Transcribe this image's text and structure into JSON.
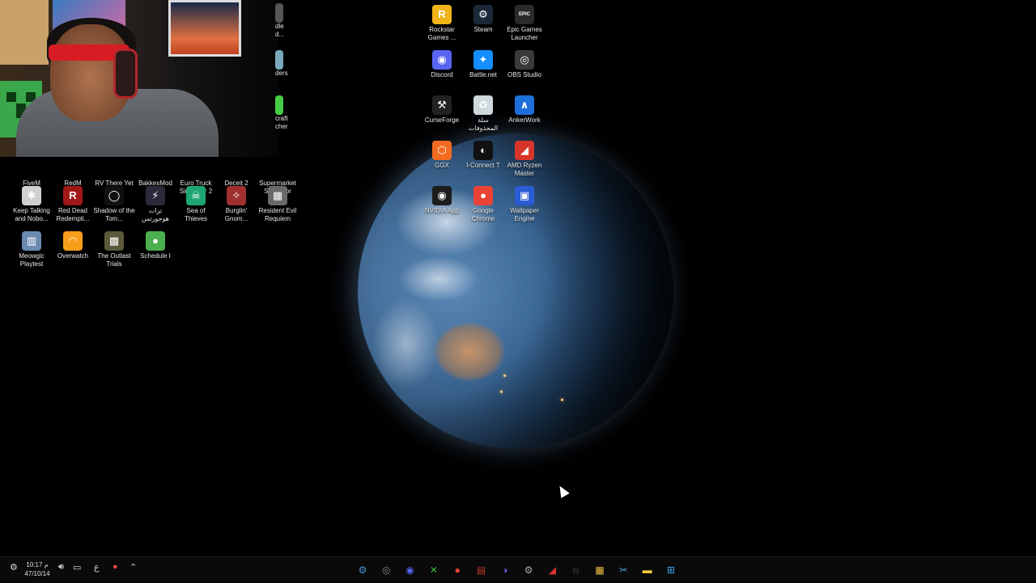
{
  "desktop_icons": [
    {
      "label": "Rockstar Games ...",
      "icon": "rockstar-icon",
      "color": "#f0b418",
      "glyph": "R"
    },
    {
      "label": "Steam",
      "icon": "steam-icon",
      "color": "#1b2838",
      "glyph": "⚙"
    },
    {
      "label": "Epic Games Launcher",
      "icon": "epic-games-icon",
      "color": "#2a2a2a",
      "glyph": "EPIC"
    },
    {
      "label": "Discord",
      "icon": "discord-icon",
      "color": "#5865f2",
      "glyph": "◉"
    },
    {
      "label": "Battle.net",
      "icon": "battlenet-icon",
      "color": "#148eff",
      "glyph": "✦"
    },
    {
      "label": "OBS Studio",
      "icon": "obs-icon",
      "color": "#3a3a3a",
      "glyph": "◎"
    },
    {
      "label": "CurseForge",
      "icon": "curseforge-icon",
      "color": "#222",
      "glyph": "⚒"
    },
    {
      "label": "سلة المحذوفات",
      "icon": "recycle-bin-icon",
      "color": "#cfd8dc",
      "glyph": "♻"
    },
    {
      "label": "AnkerWork",
      "icon": "ankerwork-icon",
      "color": "#1e6fd9",
      "glyph": "∧"
    },
    {
      "label": "GGX",
      "icon": "ggx-icon",
      "color": "#f36b21",
      "glyph": "⬡"
    },
    {
      "label": "I-Connect T",
      "icon": "iconnect-icon",
      "color": "#111",
      "glyph": "◐"
    },
    {
      "label": "AMD Ryzen Master",
      "icon": "amd-ryzen-icon",
      "color": "#d8352a",
      "glyph": "◢"
    },
    {
      "label": "NVIDIA App",
      "icon": "nvidia-icon",
      "color": "#1c1c1c",
      "glyph": "◉"
    },
    {
      "label": "Google Chrome",
      "icon": "chrome-icon",
      "color": "#ea4335",
      "glyph": "●"
    },
    {
      "label": "Wallpaper Engine",
      "icon": "wallpaper-engine-icon",
      "color": "#2a5cd8",
      "glyph": "▣"
    },
    {
      "label": "FiveM",
      "icon": "fivem-icon",
      "color": "#f26b1d",
      "glyph": ""
    },
    {
      "label": "RedM",
      "icon": "redm-icon",
      "color": "#b41e1e",
      "glyph": ""
    },
    {
      "label": "RV There Yet",
      "icon": "rv-there-yet-icon",
      "color": "#444",
      "glyph": ""
    },
    {
      "label": "BakkesMod",
      "icon": "bakkesmod-icon",
      "color": "#555",
      "glyph": ""
    },
    {
      "label": "Euro Truck Simulator 2",
      "icon": "euro-truck-icon",
      "color": "#555",
      "glyph": ""
    },
    {
      "label": "Deceit 2",
      "icon": "deceit-icon",
      "color": "#555",
      "glyph": ""
    },
    {
      "label": "Supermarket Simulator",
      "icon": "supermarket-icon",
      "color": "#555",
      "glyph": ""
    },
    {
      "label": "Keep Talking and Nobo...",
      "icon": "keep-talking-icon",
      "color": "#d0d0d0",
      "glyph": "✱"
    },
    {
      "label": "Red Dead Redempti...",
      "icon": "red-dead-icon",
      "color": "#a11818",
      "glyph": "R"
    },
    {
      "label": "Shadow of the Tom...",
      "icon": "shadow-tomb-icon",
      "color": "#111",
      "glyph": "◯"
    },
    {
      "label": "ترات هوجورتس",
      "icon": "hogwarts-icon",
      "color": "#2a2a3a",
      "glyph": "⚡"
    },
    {
      "label": "Sea of Thieves",
      "icon": "sea-of-thieves-icon",
      "color": "#1ea672",
      "glyph": "☠"
    },
    {
      "label": "Burglin' Gnom...",
      "icon": "burglin-gnomes-icon",
      "color": "#a03030",
      "glyph": "✧"
    },
    {
      "label": "Resident Evil Requiem",
      "icon": "resident-evil-icon",
      "color": "#6a6a6a",
      "glyph": "▦"
    },
    {
      "label": "Meowgic Playtest",
      "icon": "meowgic-icon",
      "color": "#6a8ab0",
      "glyph": "▥"
    },
    {
      "label": "Overwatch",
      "icon": "overwatch-icon",
      "color": "#f99e1a",
      "glyph": "◠"
    },
    {
      "label": "The Outlast Trials",
      "icon": "outlast-trials-icon",
      "color": "#5a5a3a",
      "glyph": "▩"
    },
    {
      "label": "Schedule I",
      "icon": "schedule-one-icon",
      "color": "#4caf50",
      "glyph": "●"
    }
  ],
  "partial_icons": [
    {
      "label": "dle d...",
      "icon": "partial-icon-1"
    },
    {
      "label": "ders",
      "icon": "partial-icon-2"
    },
    {
      "label": "craft cher",
      "icon": "partial-icon-3"
    }
  ],
  "taskbar": {
    "clock_time": "10:17 م",
    "clock_date": "47/10/14",
    "lang": "ع",
    "pinned": [
      {
        "name": "steam-taskbar-icon",
        "glyph": "⚙",
        "color": "#4a90d9"
      },
      {
        "name": "obs-taskbar-icon",
        "glyph": "◎",
        "color": "#888"
      },
      {
        "name": "discord-taskbar-icon",
        "glyph": "◉",
        "color": "#5865f2"
      },
      {
        "name": "xbox-taskbar-icon",
        "glyph": "✕",
        "color": "#3dbb3d"
      },
      {
        "name": "chrome-taskbar-icon",
        "glyph": "●",
        "color": "#ea4335"
      },
      {
        "name": "signalrgb-taskbar-icon",
        "glyph": "▤",
        "color": "#c0392b"
      },
      {
        "name": "app-taskbar-icon",
        "glyph": "◑",
        "color": "#6c5ce7"
      },
      {
        "name": "settings-taskbar-icon",
        "glyph": "⚙",
        "color": "#aaa"
      },
      {
        "name": "amd-taskbar-icon",
        "glyph": "◢",
        "color": "#d8352a"
      },
      {
        "name": "blackbox-taskbar-icon",
        "glyph": "⦸",
        "color": "#555"
      },
      {
        "name": "store-taskbar-icon",
        "glyph": "▦",
        "color": "#f0c040"
      },
      {
        "name": "snipping-taskbar-icon",
        "glyph": "✂",
        "color": "#4aa3df"
      },
      {
        "name": "file-explorer-taskbar-icon",
        "glyph": "▬",
        "color": "#f2c641"
      },
      {
        "name": "start-taskbar-icon",
        "glyph": "⊞",
        "color": "#3fa9f5"
      }
    ]
  }
}
